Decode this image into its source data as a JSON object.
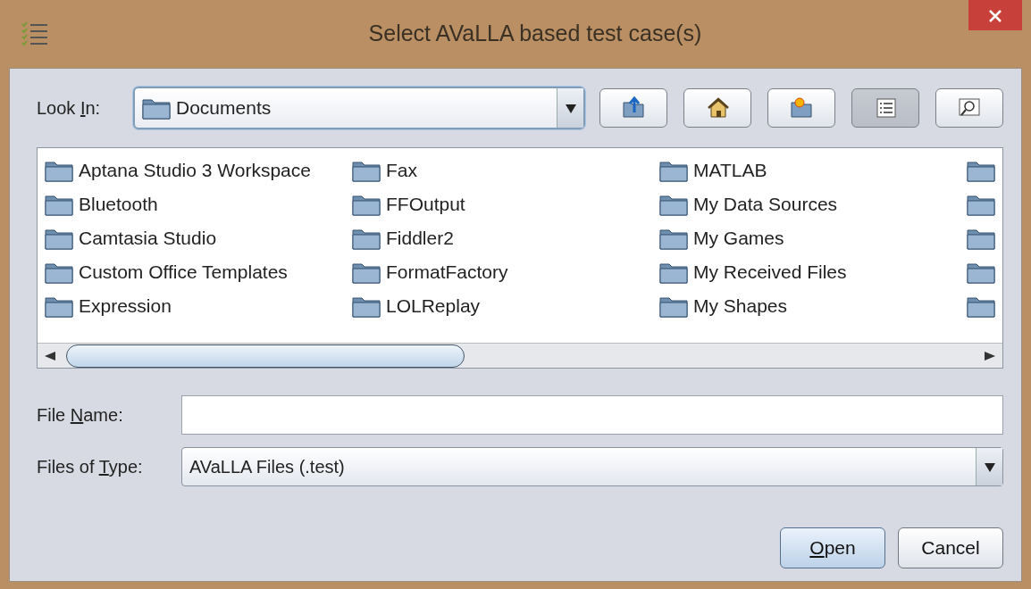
{
  "window": {
    "title": "Select AVaLLA based test case(s)"
  },
  "look_in": {
    "label": [
      {
        "text": "Look ",
        "underlined": false
      },
      {
        "text": "I",
        "underlined": true
      },
      {
        "text": "n:",
        "underlined": false
      }
    ],
    "value": "Documents"
  },
  "toolbar": [
    {
      "kind": "up",
      "selected": false
    },
    {
      "kind": "home",
      "selected": false
    },
    {
      "kind": "new-folder",
      "selected": false
    },
    {
      "kind": "list",
      "selected": true
    },
    {
      "kind": "details",
      "selected": false
    }
  ],
  "files": [
    [
      {
        "kind": "folder",
        "name": "Aptana Studio 3 Workspace"
      },
      {
        "kind": "folder",
        "name": "Bluetooth"
      },
      {
        "kind": "folder",
        "name": "Camtasia Studio"
      },
      {
        "kind": "folder",
        "name": "Custom Office Templates"
      },
      {
        "kind": "folder",
        "name": "Expression"
      }
    ],
    [
      {
        "kind": "folder",
        "name": "Fax"
      },
      {
        "kind": "folder",
        "name": "FFOutput"
      },
      {
        "kind": "folder",
        "name": "Fiddler2"
      },
      {
        "kind": "folder",
        "name": "FormatFactory"
      },
      {
        "kind": "folder",
        "name": "LOLReplay"
      }
    ],
    [
      {
        "kind": "folder",
        "name": "MATLAB"
      },
      {
        "kind": "folder",
        "name": "My Data Sources"
      },
      {
        "kind": "folder",
        "name": "My Games"
      },
      {
        "kind": "folder",
        "name": "My Received Files"
      },
      {
        "kind": "folder",
        "name": "My Shapes"
      }
    ],
    [
      {
        "kind": "folder"
      },
      {
        "kind": "folder"
      },
      {
        "kind": "folder"
      },
      {
        "kind": "folder"
      },
      {
        "kind": "folder"
      }
    ]
  ],
  "file_name": {
    "label": [
      {
        "text": "File ",
        "underlined": false
      },
      {
        "text": "N",
        "underlined": true
      },
      {
        "text": "ame:",
        "underlined": false
      }
    ]
  },
  "files_of_type": {
    "label": [
      {
        "text": "Files of ",
        "underlined": false
      },
      {
        "text": "T",
        "underlined": true
      },
      {
        "text": "ype:",
        "underlined": false
      }
    ],
    "value": "AVaLLA Files (.test)"
  },
  "buttons": [
    {
      "label": [
        {
          "text": "O",
          "underlined": true
        },
        {
          "text": "pen",
          "underlined": false
        }
      ],
      "kind": "default"
    },
    {
      "label": [
        {
          "text": "Cancel",
          "underlined": false
        }
      ],
      "kind": "normal"
    }
  ]
}
